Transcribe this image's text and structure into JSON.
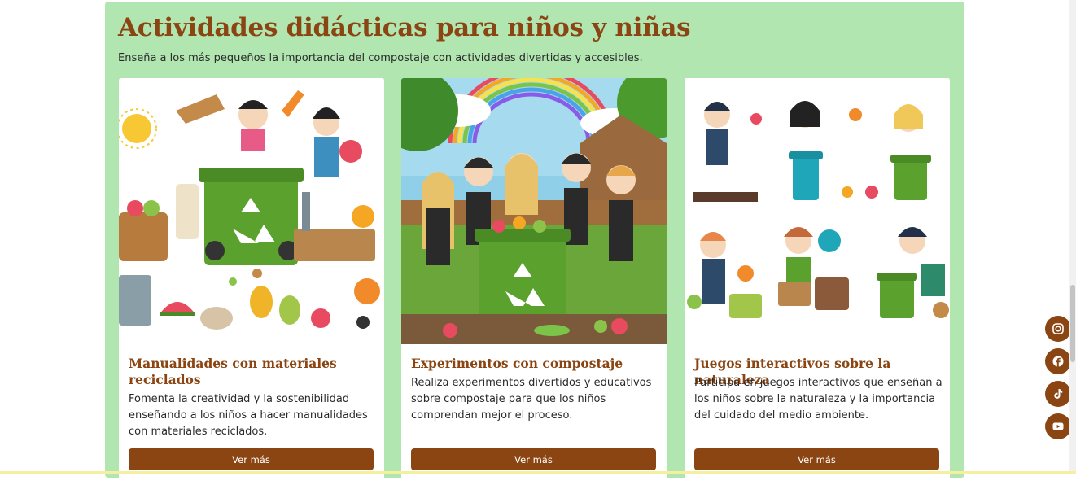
{
  "section": {
    "title": "Actividades didácticas para niños y niñas",
    "subtitle": "Enseña a los más pequeños la importancia del compostaje con actividades divertidas y accesibles."
  },
  "cards": [
    {
      "title": "Manualidades con materiales reciclados",
      "text": "Fomenta la creatividad y la sostenibilidad enseñando a los niños a hacer manualidades con materiales reciclados.",
      "button": "Ver más"
    },
    {
      "title": "Experimentos con compostaje",
      "text": "Realiza experimentos divertidos y educativos sobre compostaje para que los niños comprendan mejor el proceso.",
      "button": "Ver más"
    },
    {
      "title": "Juegos interactivos sobre la naturaleza",
      "text": "Participa en juegos interactivos que enseñan a los niños sobre la naturaleza y la importancia del cuidado del medio ambiente.",
      "button": "Ver más"
    }
  ],
  "social": [
    {
      "icon": "instagram-icon"
    },
    {
      "icon": "facebook-icon"
    },
    {
      "icon": "tiktok-icon"
    },
    {
      "icon": "youtube-icon"
    }
  ],
  "colors": {
    "section_bg": "#b2e6b1",
    "brand_brown": "#8a4512",
    "text": "#2a2a2a"
  }
}
